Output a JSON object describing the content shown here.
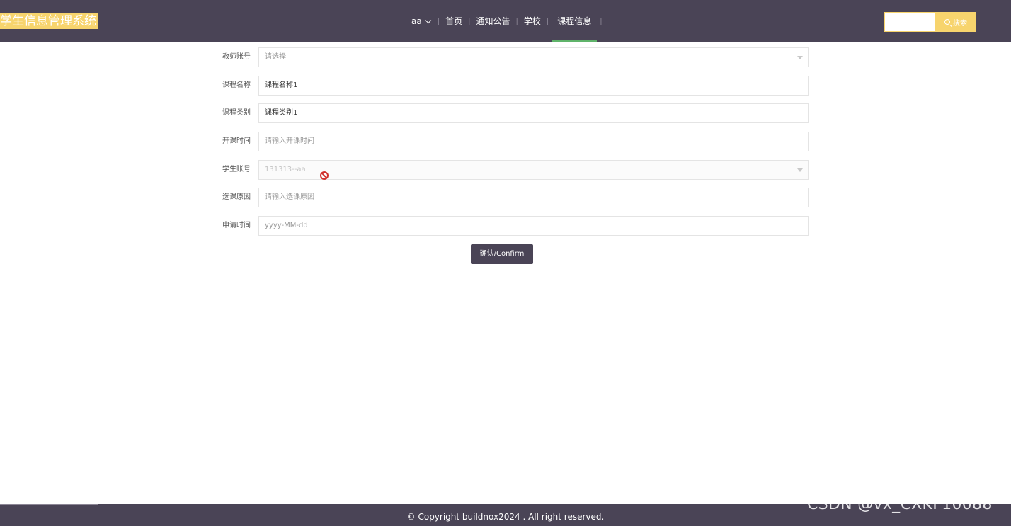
{
  "header": {
    "logo": "学生信息管理系统",
    "user": "aa",
    "nav": [
      "首页",
      "通知公告",
      "学校",
      "课程信息"
    ],
    "search_label": "搜索",
    "search_placeholder": ""
  },
  "form": {
    "fields": [
      {
        "label": "教师账号",
        "value": "请选择",
        "state": "select-placeholder"
      },
      {
        "label": "课程名称",
        "value": "课程名称1",
        "state": "filled"
      },
      {
        "label": "课程类别",
        "value": "课程类别1",
        "state": "filled"
      },
      {
        "label": "开课时间",
        "value": "请输入开课时间",
        "state": "placeholder"
      },
      {
        "label": "学生账号",
        "value": "131313--aa",
        "state": "select-disabled"
      },
      {
        "label": "选课原因",
        "value": "请输入选课原因",
        "state": "placeholder"
      },
      {
        "label": "申请时间",
        "value": "yyyy-MM-dd",
        "state": "placeholder"
      }
    ],
    "confirm_label": "确认/Confirm"
  },
  "footer": {
    "copyright": "© Copyright buildnox2024 . All right reserved."
  },
  "watermark": "CSDN @vx_CXKF10088",
  "colors": {
    "header_bg": "#4a4456",
    "accent_yellow": "#f7d46d",
    "active_underline": "#5fb36a"
  }
}
